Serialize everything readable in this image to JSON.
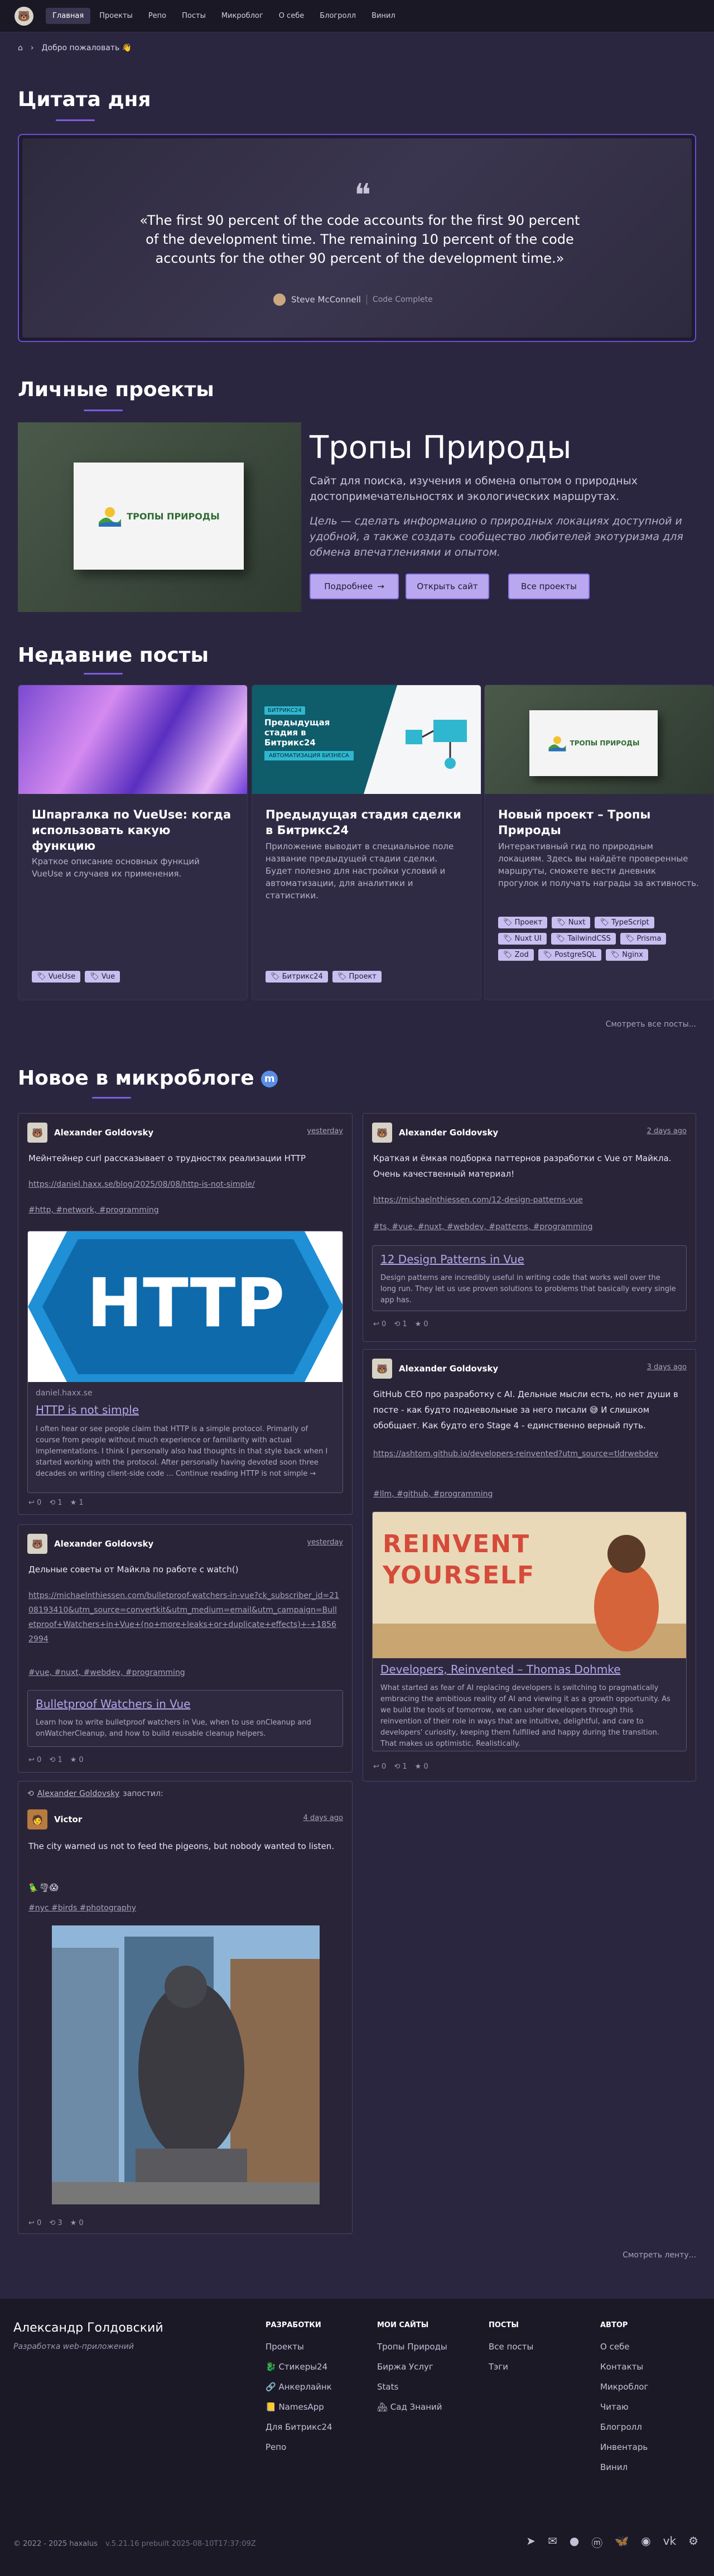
{
  "nav": {
    "logo_icon": "avatar-bear",
    "items": [
      "Главная",
      "Проекты",
      "Репо",
      "Посты",
      "Микроблог",
      "О себе",
      "Блогролл",
      "Винил"
    ],
    "active": 0
  },
  "breadcrumb": {
    "current": "Добро пожаловать 👋"
  },
  "quote": {
    "title": "Цитата дня",
    "text": "«The first 90 percent of the code accounts for the first 90 percent of the development time. The remaining 10 percent of the code accounts for the other 90 percent of the development time.»",
    "author": "Steve McConnell",
    "book": "Code Complete"
  },
  "projects": {
    "title": "Личные проекты",
    "logo_text": "ТРОПЫ ПРИРОДЫ",
    "name": "Тропы Природы",
    "description": "Сайт для поиска, изучения и обмена опытом о природных достопримечательностях и экологических маршрутах.",
    "goal": "Цель — сделать информацию о природных локациях доступной и удобной, а также создать сообщество любителей экотуризма для обмена впечатлениями и опытом.",
    "btn_more": "Подробнее",
    "btn_open": "Открыть сайт",
    "btn_all": "Все проекты"
  },
  "posts": {
    "title": "Недавние посты",
    "items": [
      {
        "title": "Шпаргалка по VueUse: когда использовать какую функцию",
        "desc": "Краткое описание основных функций VueUse и случаев их применения.",
        "tags": [
          "VueUse",
          "Vue"
        ]
      },
      {
        "title": "Предыдущая стадия сделки в Битрикс24",
        "desc": "Приложение выводит в специальное поле название предыдущей стадии сделки. Будет полезно для настройки условий и автоматизации, для аналитики и статистики.",
        "tags": [
          "Битрикс24",
          "Проект"
        ],
        "img_badge": "БИТРИКС24",
        "img_title": "Предыдущая стадия в Битрикс24",
        "img_sub": "АВТОМАТИЗАЦИЯ БИЗНЕСА"
      },
      {
        "title": "Новый проект – Тропы Природы",
        "desc": "Интерактивный гид по природным локациям. Здесь вы найдёте проверенные маршруты, сможете вести дневник прогулок и получать награды за активность.",
        "tags": [
          "Проект",
          "Nuxt",
          "TypeScript",
          "Nuxt UI",
          "TailwindCSS",
          "Prisma",
          "Zod",
          "PostgreSQL",
          "Nginx"
        ]
      }
    ],
    "see_all": "Смотреть все посты..."
  },
  "microblog": {
    "title": "Новое в микроблоге",
    "left": [
      {
        "author": "Alexander Goldovsky",
        "date": "yesterday",
        "text": "Мейнтейнер curl рассказывает о трудностях реализации HTTP",
        "link": "https://daniel.haxx.se/blog/2025/08/08/http-is-not-simple/",
        "tags": "#http, #network, #programming",
        "preview_domain": "daniel.haxx.se",
        "preview_title": "HTTP is not simple",
        "preview_text": "I often hear or see people claim that HTTP is a simple protocol. Primarily of course from people without much experience or familiarity with actual implementations. I think I personally also had thoughts in that style back when I started working with the protocol. After personally having devoted soon three decades on writing client-side code ... Continue reading HTTP is not simple →",
        "img_text": "HTTP",
        "stats": [
          "0",
          "1",
          "1"
        ]
      },
      {
        "author": "Alexander Goldovsky",
        "date": "yesterday",
        "text": "Дельные советы от Майкла по работе с watch()",
        "link": "https://michaelnthiessen.com/bulletproof-watchers-in-vue?ck_subscriber_id=2108193410&utm_source=convertkit&utm_medium=email&utm_campaign=Bulletproof+Watchers+in+Vue+(no+more+leaks+or+duplicate+effects)+-+18562994",
        "tags": "#vue, #nuxt, #webdev, #programming",
        "preview_title": "Bulletproof Watchers in Vue",
        "preview_text": "Learn how to write bulletproof watchers in Vue, when to use onCleanup and onWatcherCleanup, and how to build reusable cleanup helpers.",
        "stats": [
          "0",
          "1",
          "0"
        ]
      },
      {
        "repost_author": "Alexander Goldovsky",
        "repost_label": "запостил:",
        "author": "Victor",
        "date": "4 days ago",
        "text": "The city warned us not to feed the pigeons, but nobody wanted to listen.",
        "emoji": "🦜🌪😱",
        "tags": "#nyc #birds #photography",
        "stats": [
          "0",
          "3",
          "0"
        ]
      }
    ],
    "right": [
      {
        "author": "Alexander Goldovsky",
        "date": "2 days ago",
        "text": "Краткая и ёмкая подборка паттернов разработки с Vue от Майкла. Очень качественный материал!",
        "link": "https://michaelnthiessen.com/12-design-patterns-vue",
        "tags": "#ts, #vue, #nuxt, #webdev, #patterns, #programming",
        "preview_title": "12 Design Patterns in Vue",
        "preview_text": "Design patterns are incredibly useful in writing code that works well over the long run. They let us use proven solutions to problems that basically every single app has.",
        "stats": [
          "0",
          "1",
          "0"
        ]
      },
      {
        "author": "Alexander Goldovsky",
        "date": "3 days ago",
        "text": "GitHub CEO про разработку с AI. Дельные мысли есть, но нет души в посте - как будто подневольные за него писали 😅 И слишком обобщает. Как будто его Stage 4 - единственно верный путь.",
        "link": "https://ashtom.github.io/developers-reinvented?utm_source=tldrwebdev",
        "tags": "#llm, #github, #programming",
        "img_text": "REINVENT YOURSELF",
        "preview_title": "Developers, Reinvented – Thomas Dohmke",
        "preview_text": "What started as fear of AI replacing developers is switching to pragmatically embracing the ambitious reality of AI and viewing it as a growth opportunity. As we build the tools of tomorrow, we can usher developers through this reinvention of their role in ways that are intuitive, delightful, and care to developers' curiosity, keeping them fulfilled and happy during the transition. That makes us optimistic. Realistically.",
        "stats": [
          "0",
          "1",
          "0"
        ]
      }
    ],
    "see_more": "Смотреть ленту..."
  },
  "footer": {
    "name": "Александр Голдовский",
    "role": "Разработка web-приложений",
    "cols": [
      {
        "title": "РАЗРАБОТКИ",
        "items": [
          "Проекты",
          "🐉 Стикеры24",
          "🔗 Анкерлайнк",
          "📒 NamesApp",
          "Для Битрикс24",
          "Репо"
        ]
      },
      {
        "title": "МОИ САЙТЫ",
        "items": [
          "Тропы Природы",
          "Биржа Услуг",
          "Stats",
          "🏘 Сад Знаний"
        ]
      },
      {
        "title": "ПОСТЫ",
        "items": [
          "Все посты",
          "Тэги"
        ]
      },
      {
        "title": "АВТОР",
        "items": [
          "О себе",
          "Контакты",
          "Микроблог",
          "Читаю",
          "Блогролл",
          "Инвентарь",
          "Винил"
        ]
      }
    ],
    "copyright": "© 2022 - 2025 haxalus",
    "build": "v.5.21.16 prebuilt 2025-08-10T17:37:09Z",
    "socials": [
      "telegram-icon",
      "email-icon",
      "github-icon",
      "mastodon-icon",
      "bluesky-icon",
      "rss-icon",
      "vk-icon",
      "steam-icon"
    ]
  }
}
